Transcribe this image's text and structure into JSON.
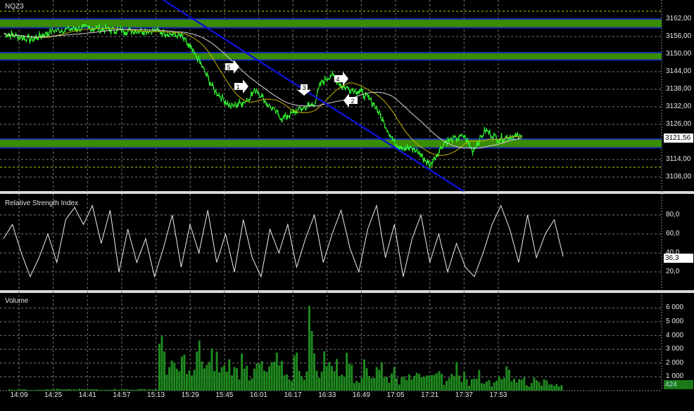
{
  "symbol": "NQZ3",
  "panels": {
    "rsi_title": "Relative Strength Index",
    "volume_title": "Volume"
  },
  "price_axis": {
    "ticks": [
      "3162,00",
      "3156,00",
      "3150,00",
      "3144,00",
      "3138,00",
      "3132,00",
      "3126,00",
      "3114,00",
      "3108,00"
    ],
    "current": "3121,56"
  },
  "rsi_axis": {
    "ticks": [
      "80,0",
      "60,0",
      "40,0",
      "20,0"
    ],
    "current": "36,3"
  },
  "volume_axis": {
    "ticks": [
      "6 000",
      "5 000",
      "4 000",
      "3 000",
      "2 000",
      "1 000"
    ],
    "current": "424"
  },
  "time_axis": [
    "14:09",
    "14:25",
    "14:41",
    "14:57",
    "15:13",
    "15:29",
    "15:45",
    "16:01",
    "16:17",
    "16:33",
    "16:49",
    "17:05",
    "17:21",
    "17:37",
    "17:53"
  ],
  "markers": [
    "5",
    "1",
    "3",
    "2",
    "4"
  ],
  "colors": {
    "price": "#33ff33",
    "band": "#3a8c00",
    "band_edge": "#1a2fb0",
    "trendline": "#1010d0",
    "ma_fast": "#c8b400",
    "ma_slow": "#d8d8d8",
    "volume": "#1f8a1f"
  },
  "chart_data": [
    {
      "type": "line",
      "title": "NQZ3",
      "ylim": [
        3104,
        3166
      ],
      "x": [
        "14:02",
        "14:15",
        "14:25",
        "14:41",
        "14:57",
        "15:13",
        "15:25",
        "15:33",
        "15:40",
        "15:48",
        "15:55",
        "16:00",
        "16:05",
        "16:12",
        "16:20",
        "16:27",
        "16:30",
        "16:35",
        "16:40",
        "16:49",
        "16:55",
        "17:00",
        "17:05",
        "17:15",
        "17:21",
        "17:28",
        "17:37",
        "17:41",
        "17:47",
        "17:53",
        "18:00",
        "18:04"
      ],
      "values": [
        3157,
        3155,
        3158,
        3159,
        3158,
        3158,
        3156,
        3148,
        3138,
        3132,
        3134,
        3138,
        3133,
        3128,
        3131,
        3133,
        3140,
        3143,
        3139,
        3137,
        3133,
        3126,
        3119,
        3117,
        3112,
        3120,
        3122,
        3117,
        3124,
        3121,
        3122,
        3121.56
      ],
      "bands": [
        [
          3159,
          3162
        ],
        [
          3148,
          3150.5
        ],
        [
          3118,
          3121
        ]
      ]
    },
    {
      "type": "line",
      "title": "Relative Strength Index",
      "ylim": [
        0,
        100
      ],
      "values": [
        55,
        70,
        40,
        15,
        35,
        60,
        30,
        75,
        88,
        70,
        90,
        50,
        85,
        20,
        65,
        30,
        55,
        15,
        45,
        80,
        25,
        70,
        40,
        85,
        30,
        60,
        20,
        75,
        35,
        15,
        65,
        40,
        70,
        25,
        55,
        80,
        30,
        60,
        85,
        45,
        20,
        65,
        90,
        35,
        70,
        15,
        55,
        80,
        30,
        60,
        20,
        50,
        25,
        15,
        40,
        70,
        90,
        65,
        30,
        80,
        35,
        60,
        75,
        36.3
      ]
    },
    {
      "type": "bar",
      "title": "Volume",
      "ylim": [
        0,
        6500
      ],
      "values": [
        100,
        120,
        90,
        80,
        110,
        100,
        130,
        90,
        100,
        120,
        90,
        110,
        80,
        100,
        120,
        100,
        90,
        110,
        130,
        100,
        3600,
        2200,
        1800,
        2600,
        1500,
        3400,
        2100,
        2800,
        1900,
        2400,
        1700,
        3000,
        1400,
        2200,
        1600,
        2500,
        1900,
        1300,
        2700,
        1600,
        5800,
        1400,
        3300,
        2100,
        1800,
        2600,
        1200,
        2000,
        1500,
        2300,
        1100,
        1800,
        900,
        1400,
        2200,
        1700,
        1000,
        1300,
        900,
        2100,
        1200,
        800,
        1500,
        1100,
        700,
        1300,
        1600,
        900,
        1200,
        600,
        1000,
        800,
        500,
        424
      ]
    }
  ]
}
